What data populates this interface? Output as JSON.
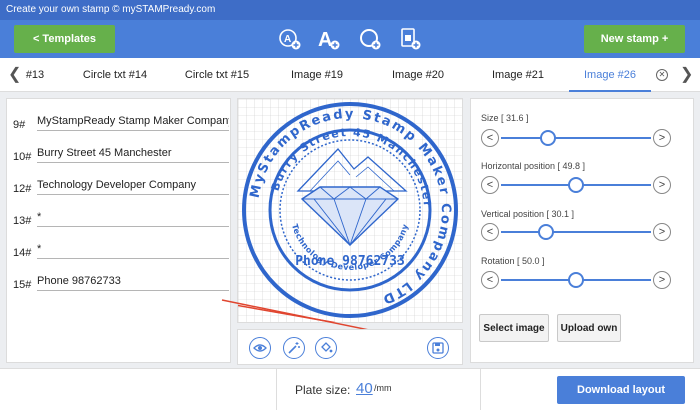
{
  "window": {
    "title": "Create your own stamp © mySTAMPready.com"
  },
  "toolbar": {
    "templates_label": "<  Templates",
    "new_stamp_label": "New stamp +",
    "icons": [
      "add-circle-text-icon",
      "add-text-icon",
      "add-shape-icon",
      "add-image-icon"
    ]
  },
  "tabs": {
    "items": [
      {
        "label": "#13"
      },
      {
        "label": "Circle txt #14"
      },
      {
        "label": "Circle txt #15"
      },
      {
        "label": "Image #19"
      },
      {
        "label": "Image #20"
      },
      {
        "label": "Image #21"
      },
      {
        "label": "Image #26"
      }
    ],
    "active_index": 6
  },
  "lines": [
    {
      "num": "9#",
      "value": "MyStampReady Stamp Maker Company ..."
    },
    {
      "num": "10#",
      "value": "Burry Street 45 Manchester"
    },
    {
      "num": "12#",
      "value": "Technology Developer Company"
    },
    {
      "num": "13#",
      "value": "*"
    },
    {
      "num": "14#",
      "value": "*"
    },
    {
      "num": "15#",
      "value": "Phone 98762733"
    }
  ],
  "stamp": {
    "outer_text": "MyStampReady Stamp Maker Company LTD",
    "middle_text": "Burry Street 45 Manchester",
    "inner_text": "Technology Developer Company",
    "center_text": "Phone 98762733",
    "color": "#2f66cc"
  },
  "controls": {
    "size_label": "Size [ 31.6 ]",
    "size_value": 31.6,
    "hpos_label": "Horizontal position [ 49.8 ]",
    "hpos_value": 49.8,
    "vpos_label": "Vertical position [ 30.1 ]",
    "vpos_value": 30.1,
    "rotation_label": "Rotation [ 50.0 ]",
    "rotation_value": 50.0,
    "select_image": "Select image",
    "upload_own": "Upload own"
  },
  "preview_tools": [
    "eye-icon",
    "magic-wand-icon",
    "paint-bucket-icon",
    "save-icon"
  ],
  "footer": {
    "plate_size_label": "Plate size:",
    "plate_size_value": "40",
    "plate_unit": "/mm",
    "download_label": "Download layout"
  },
  "colors": {
    "accent": "#4a7fd9",
    "green": "#66b04b",
    "arrow": "#e0452f"
  }
}
